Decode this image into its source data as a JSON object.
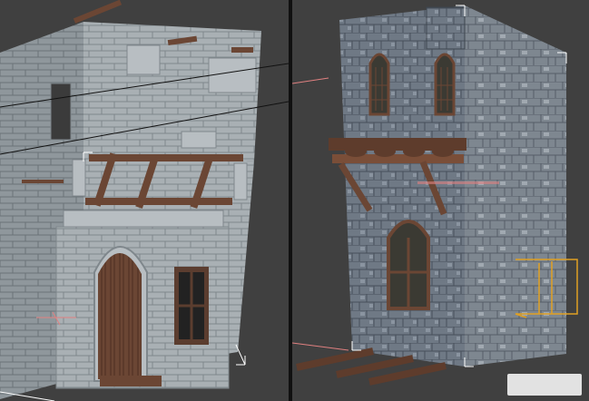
{
  "app": {
    "viewports": [
      {
        "name": "perspective-left",
        "active": false
      },
      {
        "name": "perspective-right",
        "active": false
      }
    ]
  },
  "colors": {
    "viewport_bg": "#404040",
    "selection_bracket": "#ffffff",
    "gizmo_orange": "#e0a022",
    "grid_pink": "#e08080"
  },
  "icons": {
    "watermark": "watermark-logo"
  }
}
